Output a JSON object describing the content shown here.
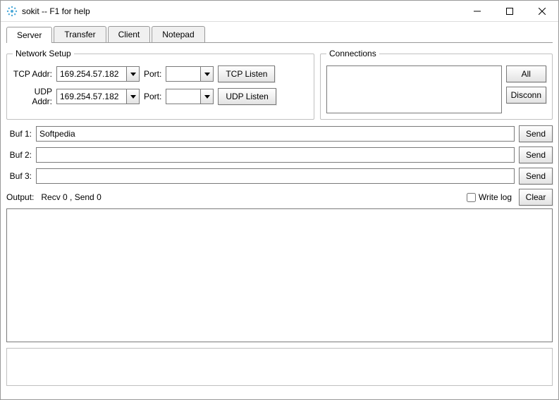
{
  "window": {
    "title": "sokit -- F1 for help"
  },
  "tabs": {
    "items": [
      "Server",
      "Transfer",
      "Client",
      "Notepad"
    ],
    "active": 0
  },
  "netsetup": {
    "legend": "Network Setup",
    "tcp_label": "TCP Addr:",
    "tcp_addr": "169.254.57.182",
    "tcp_port_label": "Port:",
    "tcp_port": "",
    "tcp_listen": "TCP Listen",
    "udp_label": "UDP Addr:",
    "udp_addr": "169.254.57.182",
    "udp_port_label": "Port:",
    "udp_port": "",
    "udp_listen": "UDP Listen"
  },
  "connections": {
    "legend": "Connections",
    "all": "All",
    "disconn": "Disconn"
  },
  "buffers": {
    "buf1_label": "Buf 1:",
    "buf1_value": "Softpedia",
    "buf2_label": "Buf 2:",
    "buf2_value": "",
    "buf3_label": "Buf 3:",
    "buf3_value": "",
    "send": "Send"
  },
  "output": {
    "label": "Output:",
    "stats": "Recv 0 , Send 0",
    "write_log": "Write log",
    "clear": "Clear"
  }
}
